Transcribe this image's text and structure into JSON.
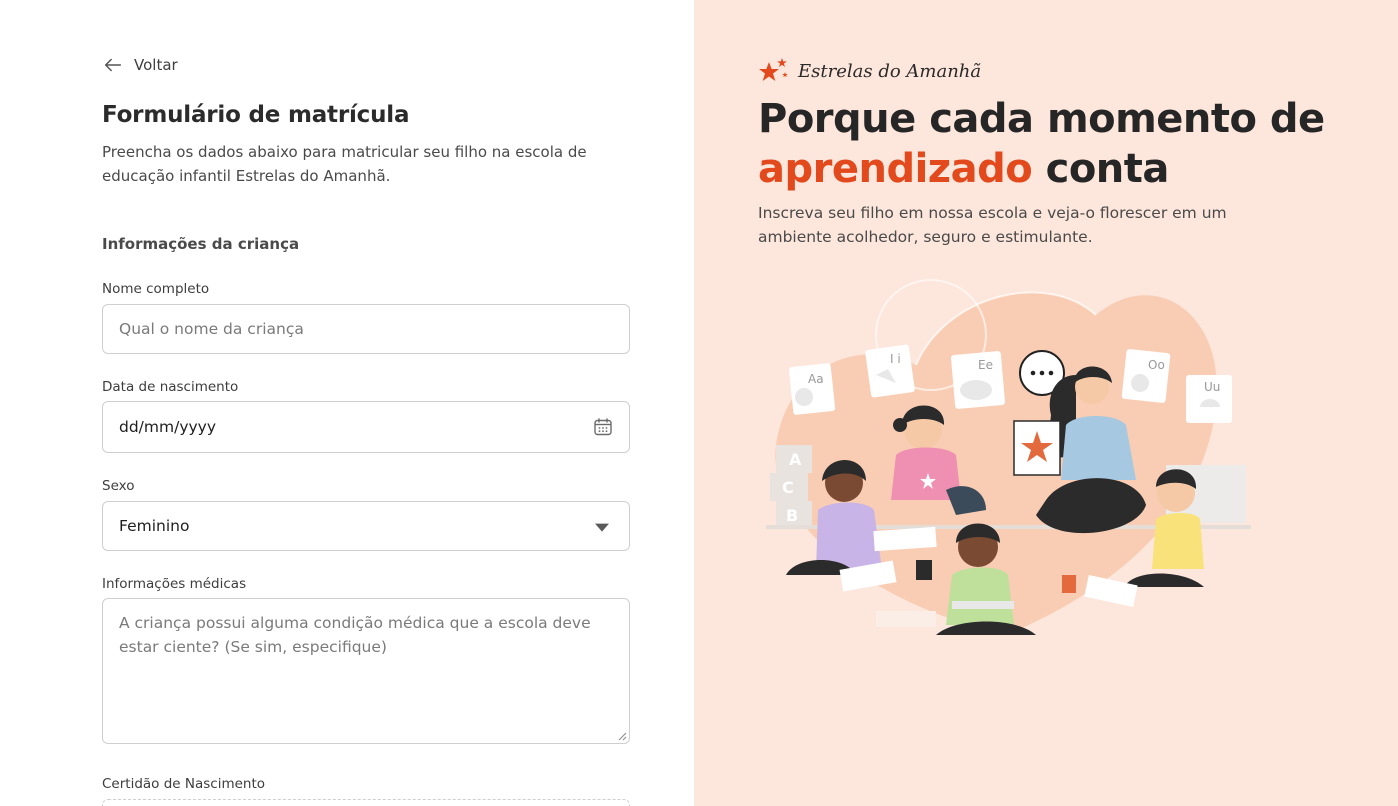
{
  "form": {
    "back_label": "Voltar",
    "title": "Formulário de matrícula",
    "subtitle": "Preencha os dados abaixo para matricular seu filho na escola de educação infantil Estrelas do Amanhã.",
    "section_title": "Informações da criança",
    "full_name": {
      "label": "Nome completo",
      "placeholder": "Qual o nome da criança"
    },
    "birth_date": {
      "label": "Data de nascimento",
      "value": "dd/mm/yyyy"
    },
    "sex": {
      "label": "Sexo",
      "selected": "Feminino"
    },
    "medical": {
      "label": "Informações médicas",
      "placeholder": "A criança possui alguma condição médica que a escola deve estar ciente? (Se sim, especifique)"
    },
    "birth_certificate": {
      "label": "Certidão de Nascimento"
    }
  },
  "promo": {
    "brand_name": "Estrelas do Amanhã",
    "headline_part1": "Porque cada momento de ",
    "headline_accent": "aprendizado",
    "headline_part2": " conta",
    "lead": "Inscreva seu filho em nossa escola e veja-o florescer em um ambiente acolhedor, seguro e estimulante.",
    "illustration_cards": [
      "Aa",
      "I i",
      "Ee",
      "Oo",
      "Uu",
      "A",
      "C",
      "B"
    ]
  },
  "colors": {
    "accent": "#e24a1d",
    "panel_bg": "#fde6db",
    "heart": "#f9cdb4"
  }
}
